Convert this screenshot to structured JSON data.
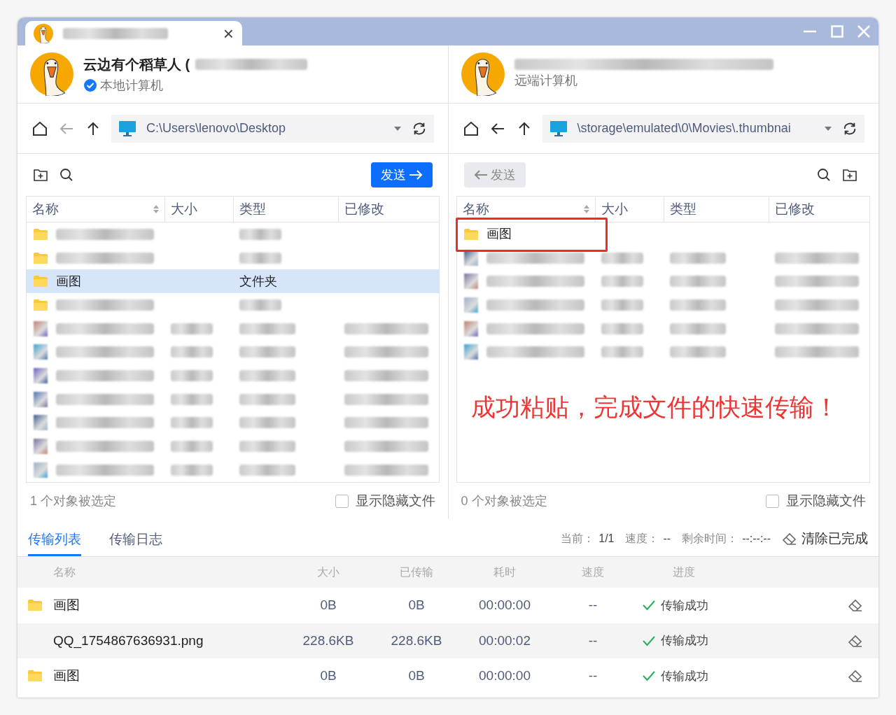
{
  "tab": {
    "close": "×"
  },
  "panels": [
    {
      "user_name": "云边有个稻草人 (",
      "verified": true,
      "subtitle": "本地计算机",
      "path": "C:\\Users\\lenovo\\Desktop",
      "back_enabled": false,
      "send": {
        "label": "发送",
        "enabled": true
      },
      "columns": [
        "名称",
        "大小",
        "类型",
        "已修改"
      ],
      "rows": [
        {
          "kind": "redacted-folder",
          "selected": false
        },
        {
          "kind": "redacted-folder",
          "selected": false
        },
        {
          "kind": "folder",
          "name": "画图",
          "type": "文件夹",
          "selected": true,
          "outlined": false
        },
        {
          "kind": "redacted-folder",
          "selected": false
        },
        {
          "kind": "redacted-file",
          "selected": false
        },
        {
          "kind": "redacted-file",
          "selected": false
        },
        {
          "kind": "redacted-file",
          "selected": false
        },
        {
          "kind": "redacted-file",
          "selected": false
        },
        {
          "kind": "redacted-file",
          "selected": false
        },
        {
          "kind": "redacted-file",
          "selected": false
        },
        {
          "kind": "redacted-file",
          "selected": false
        }
      ],
      "selection_count": "1 个对象被选定",
      "show_hidden": {
        "label": "显示隐藏文件",
        "checked": false
      }
    },
    {
      "subtitle": "远端计算机",
      "verified": false,
      "path": "\\storage\\emulated\\0\\Movies\\.thumbnai",
      "back_enabled": true,
      "send": {
        "label": "发送",
        "enabled": false
      },
      "columns": [
        "名称",
        "大小",
        "类型",
        "已修改"
      ],
      "rows": [
        {
          "kind": "folder",
          "name": "画图",
          "selected": false,
          "outlined": true
        },
        {
          "kind": "redacted-file",
          "selected": false
        },
        {
          "kind": "redacted-file",
          "selected": false
        },
        {
          "kind": "redacted-file",
          "selected": false
        },
        {
          "kind": "redacted-file",
          "selected": false
        },
        {
          "kind": "redacted-file",
          "selected": false
        }
      ],
      "annotation": "成功粘贴，完成文件的快速传输！",
      "selection_count": "0 个对象被选定",
      "show_hidden": {
        "label": "显示隐藏文件",
        "checked": false
      }
    }
  ],
  "transfer": {
    "tabs": [
      {
        "label": "传输列表",
        "selected": true
      },
      {
        "label": "传输日志",
        "selected": false
      }
    ],
    "stats": [
      {
        "label": "当前：",
        "value": "1/1"
      },
      {
        "label": "速度：",
        "value": "--"
      },
      {
        "label": "剩余时间：",
        "value": "--:--:--"
      }
    ],
    "clear_button": "清除已完成",
    "columns": [
      "名称",
      "大小",
      "已传输",
      "耗时",
      "速度",
      "进度"
    ],
    "rows": [
      {
        "kind": "folder",
        "name": "画图",
        "size": "0B",
        "transferred": "0B",
        "elapsed": "00:00:00",
        "speed": "--",
        "status": "传输成功"
      },
      {
        "kind": "file",
        "name": "QQ_1754867636931.png",
        "size": "228.6KB",
        "transferred": "228.6KB",
        "elapsed": "00:00:02",
        "speed": "--",
        "status": "传输成功"
      },
      {
        "kind": "folder",
        "name": "画图",
        "size": "0B",
        "transferred": "0B",
        "elapsed": "00:00:00",
        "speed": "--",
        "status": "传输成功"
      }
    ]
  }
}
